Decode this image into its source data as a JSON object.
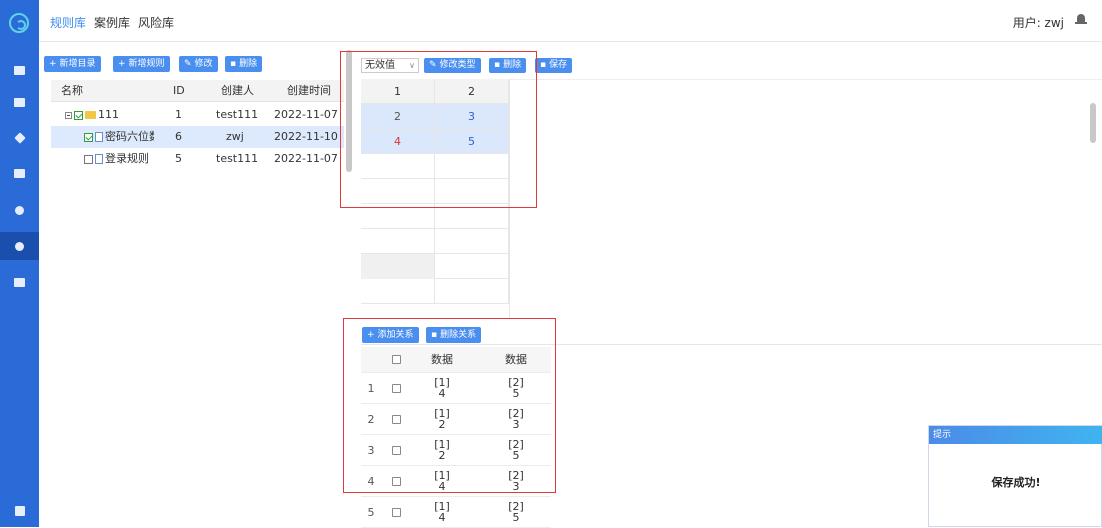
{
  "topbar": {
    "tabs": [
      {
        "label": "规则库",
        "active": true
      },
      {
        "label": "案例库",
        "active": false
      },
      {
        "label": "风险库",
        "active": false
      }
    ],
    "user_label": "用户: zwj"
  },
  "toolbar_left": {
    "add_dir": "新增目录",
    "add_rule": "新增规则",
    "edit": "修改",
    "delete": "删除"
  },
  "tree": {
    "columns": [
      "名称",
      "ID",
      "创建人",
      "创建时间"
    ],
    "rows": [
      {
        "name": "111",
        "id": "1",
        "creator": "test111",
        "time": "2022-11-07"
      },
      {
        "name": "密码六位数",
        "id": "6",
        "creator": "zwj",
        "time": "2022-11-10"
      },
      {
        "name": "登录规则",
        "id": "5",
        "creator": "test111",
        "time": "2022-11-07"
      }
    ]
  },
  "toolbar_mid": {
    "select_value": "无效值",
    "change_type": "修改类型",
    "delete": "删除",
    "save": "保存"
  },
  "grid": {
    "headers": [
      "1",
      "2"
    ],
    "rows": [
      [
        "2",
        "3"
      ],
      [
        "4",
        "5"
      ]
    ]
  },
  "relation": {
    "add": "添加关系",
    "delete": "删除关系",
    "headers": [
      "数据",
      "数据"
    ],
    "rows": [
      {
        "n": "1",
        "a_top": "[1]",
        "a_bot": "4",
        "b_top": "[2]",
        "b_bot": "5"
      },
      {
        "n": "2",
        "a_top": "[1]",
        "a_bot": "2",
        "b_top": "[2]",
        "b_bot": "3"
      },
      {
        "n": "3",
        "a_top": "[1]",
        "a_bot": "2",
        "b_top": "[2]",
        "b_bot": "5"
      },
      {
        "n": "4",
        "a_top": "[1]",
        "a_bot": "4",
        "b_top": "[2]",
        "b_bot": "3"
      },
      {
        "n": "5",
        "a_top": "[1]",
        "a_bot": "4",
        "b_top": "[2]",
        "b_bot": "5"
      }
    ]
  },
  "toast": {
    "title": "提示",
    "message": "保存成功!"
  },
  "colors": {
    "sidebar": "#2a6bd8",
    "accent": "#4a8ef0",
    "annotation": "#e0393b",
    "highlight": "#dbe8fb"
  }
}
